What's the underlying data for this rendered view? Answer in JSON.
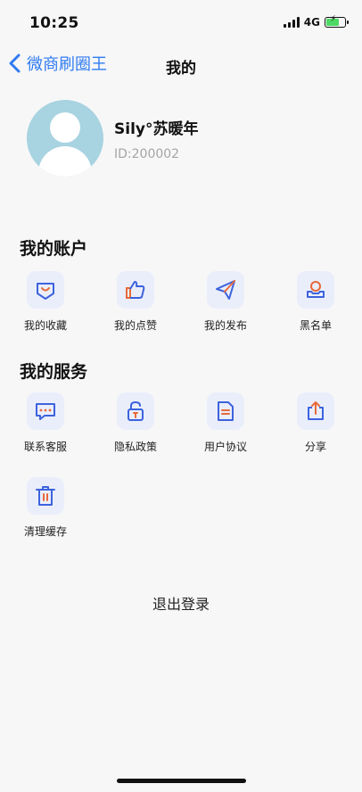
{
  "status_bar": {
    "time": "10:25",
    "network": "4G"
  },
  "nav": {
    "back_label": "微商刷圈王",
    "title": "我的"
  },
  "profile": {
    "name": "Sily°苏暖年",
    "id_text": "ID:200002"
  },
  "account_section": {
    "title": "我的账户",
    "items": [
      {
        "label": "我的收藏",
        "icon": "heart-box-icon"
      },
      {
        "label": "我的点赞",
        "icon": "thumbs-up-icon"
      },
      {
        "label": "我的发布",
        "icon": "paper-plane-icon"
      },
      {
        "label": "黑名单",
        "icon": "user-block-icon"
      }
    ]
  },
  "service_section": {
    "title": "我的服务",
    "items": [
      {
        "label": "联系客服",
        "icon": "chat-bubble-icon"
      },
      {
        "label": "隐私政策",
        "icon": "padlock-icon"
      },
      {
        "label": "用户协议",
        "icon": "document-icon"
      },
      {
        "label": "分享",
        "icon": "share-icon"
      },
      {
        "label": "清理缓存",
        "icon": "trash-icon"
      }
    ]
  },
  "logout_label": "退出登录",
  "colors": {
    "accent": "#2f7bf0",
    "icon_blue": "#3d63dd",
    "icon_orange": "#e8683a",
    "icon_bg": "#eaeefb",
    "avatar_bg": "#a8d3e1"
  }
}
